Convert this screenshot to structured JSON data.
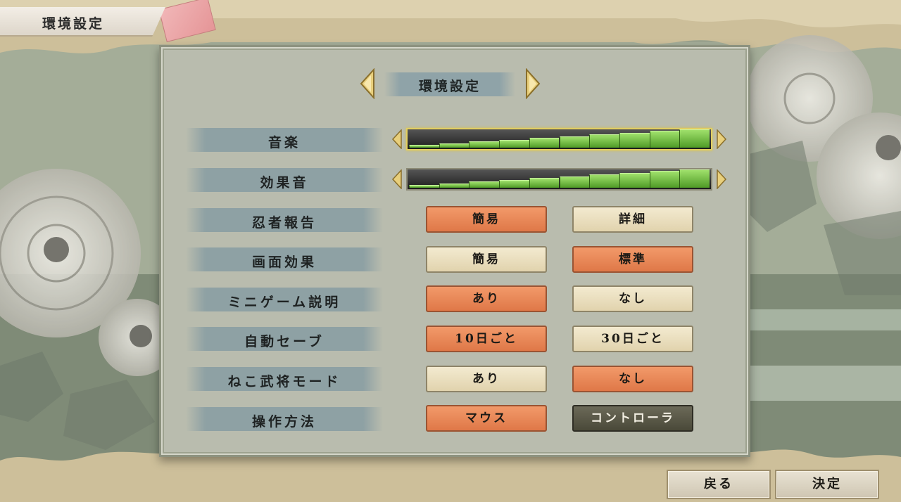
{
  "window": {
    "title": "環境設定"
  },
  "panel": {
    "header_label": "環境設定"
  },
  "volume": {
    "music": {
      "label": "音楽",
      "level": 1.0
    },
    "sfx": {
      "label": "効果音",
      "level": 1.0
    }
  },
  "settings": [
    {
      "label": "忍者報告",
      "options": [
        "簡易",
        "詳細"
      ],
      "selected": 0
    },
    {
      "label": "画面効果",
      "options": [
        "簡易",
        "標準"
      ],
      "selected": 1
    },
    {
      "label": "ミニゲーム説明",
      "options": [
        "あり",
        "なし"
      ],
      "selected": 0
    },
    {
      "label": "自動セーブ",
      "options": [
        "10日ごと",
        "30日ごと"
      ],
      "selected": 0
    },
    {
      "label": "ねこ武将モード",
      "options": [
        "あり",
        "なし"
      ],
      "selected": 1
    },
    {
      "label": "操作方法",
      "options": [
        "マウス",
        "コントローラ"
      ],
      "selected": 0,
      "disabled_option": 1
    }
  ],
  "footer": {
    "back_label": "戻る",
    "confirm_label": "決定"
  },
  "colors": {
    "option_selected": "#e8875a",
    "option_unselected": "#ecdfbf",
    "option_disabled": "#5b5a49",
    "slider_fill": "#6fbf3a",
    "label_band": "#8ea1a4"
  }
}
